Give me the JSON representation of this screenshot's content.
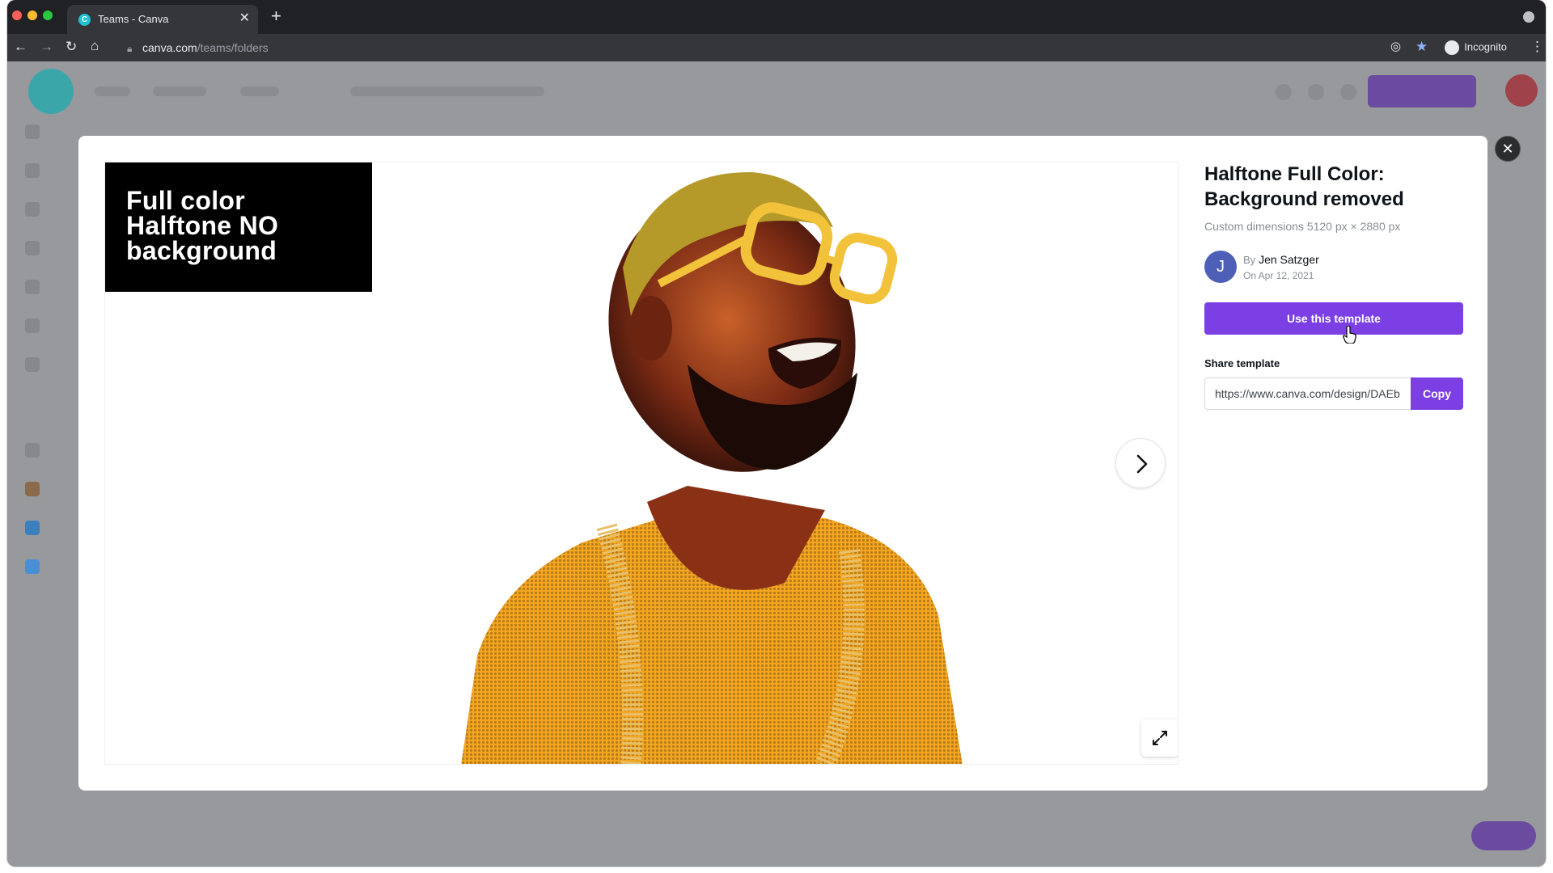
{
  "browser": {
    "tab_title": "Teams - Canva",
    "tab_favicon": "C",
    "url_host": "canva.com",
    "url_path": "/teams/folders",
    "incognito_label": "Incognito",
    "colors": {
      "tabstrip": "#202124",
      "toolbar": "#35363a"
    }
  },
  "modal": {
    "preview_label": "Full color\nHalftone NO\nbackground",
    "title": "Halftone Full Color: Background removed",
    "dimensions": "Custom dimensions 5120 px × 2880 px",
    "author": {
      "initial": "J",
      "by_prefix": "By",
      "name": "Jen Satzger",
      "date": "On Apr 12, 2021"
    },
    "use_button": "Use this template",
    "share_label": "Share template",
    "share_url": "https://www.canva.com/design/DAEb",
    "copy_button": "Copy",
    "accent_color": "#7b3fe4"
  },
  "icons": {
    "close": "close-icon",
    "next": "chevron-right-icon",
    "expand": "expand-icon"
  }
}
